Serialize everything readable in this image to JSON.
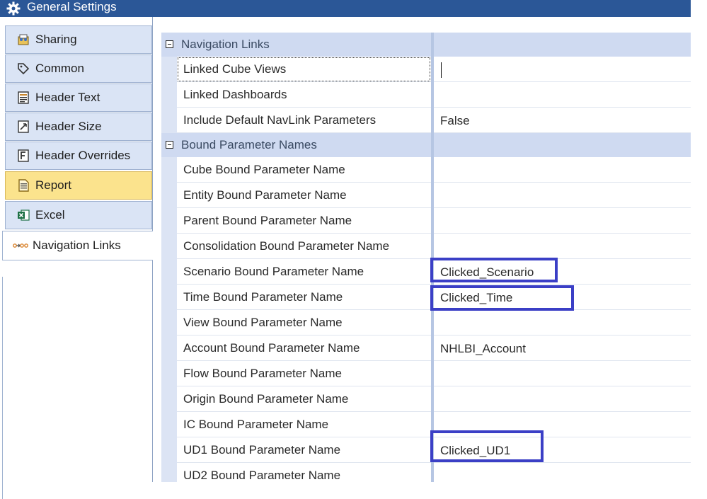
{
  "window": {
    "title": "General Settings"
  },
  "sidebar": {
    "items": [
      {
        "label": "Sharing",
        "icon": "sharing-icon"
      },
      {
        "label": "Common",
        "icon": "tag-icon"
      },
      {
        "label": "Header Text",
        "icon": "header-text-icon"
      },
      {
        "label": "Header Size",
        "icon": "header-size-icon"
      },
      {
        "label": "Header Overrides",
        "icon": "header-overrides-icon"
      },
      {
        "label": "Report",
        "icon": "report-icon",
        "active": true
      },
      {
        "label": "Excel",
        "icon": "excel-icon"
      },
      {
        "label": "Navigation Links",
        "icon": "navigation-links-icon"
      }
    ]
  },
  "properties": {
    "categories": [
      {
        "title": "Navigation Links",
        "rows": [
          {
            "name": "Linked Cube Views",
            "value": ""
          },
          {
            "name": "Linked Dashboards",
            "value": ""
          },
          {
            "name": "Include Default NavLink Parameters",
            "value": "False"
          }
        ]
      },
      {
        "title": "Bound Parameter Names",
        "rows": [
          {
            "name": "Cube Bound Parameter Name",
            "value": ""
          },
          {
            "name": "Entity Bound Parameter Name",
            "value": ""
          },
          {
            "name": "Parent Bound Parameter Name",
            "value": ""
          },
          {
            "name": "Consolidation Bound Parameter Name",
            "value": ""
          },
          {
            "name": "Scenario Bound Parameter Name",
            "value": "Clicked_Scenario"
          },
          {
            "name": "Time Bound Parameter Name",
            "value": "Clicked_Time"
          },
          {
            "name": "View Bound Parameter Name",
            "value": ""
          },
          {
            "name": "Account Bound Parameter Name",
            "value": "NHLBI_Account"
          },
          {
            "name": "Flow Bound Parameter Name",
            "value": ""
          },
          {
            "name": "Origin Bound Parameter Name",
            "value": ""
          },
          {
            "name": "IC Bound Parameter Name",
            "value": ""
          },
          {
            "name": "UD1 Bound Parameter Name",
            "value": "Clicked_UD1"
          },
          {
            "name": "UD2 Bound Parameter Name",
            "value": ""
          }
        ]
      }
    ]
  },
  "colors": {
    "titlebar": "#2b5797",
    "nav_item": "#dae4f5",
    "nav_active": "#fbe38d",
    "category_header": "#cfdaf1",
    "highlight_box": "#3b3fc6"
  }
}
